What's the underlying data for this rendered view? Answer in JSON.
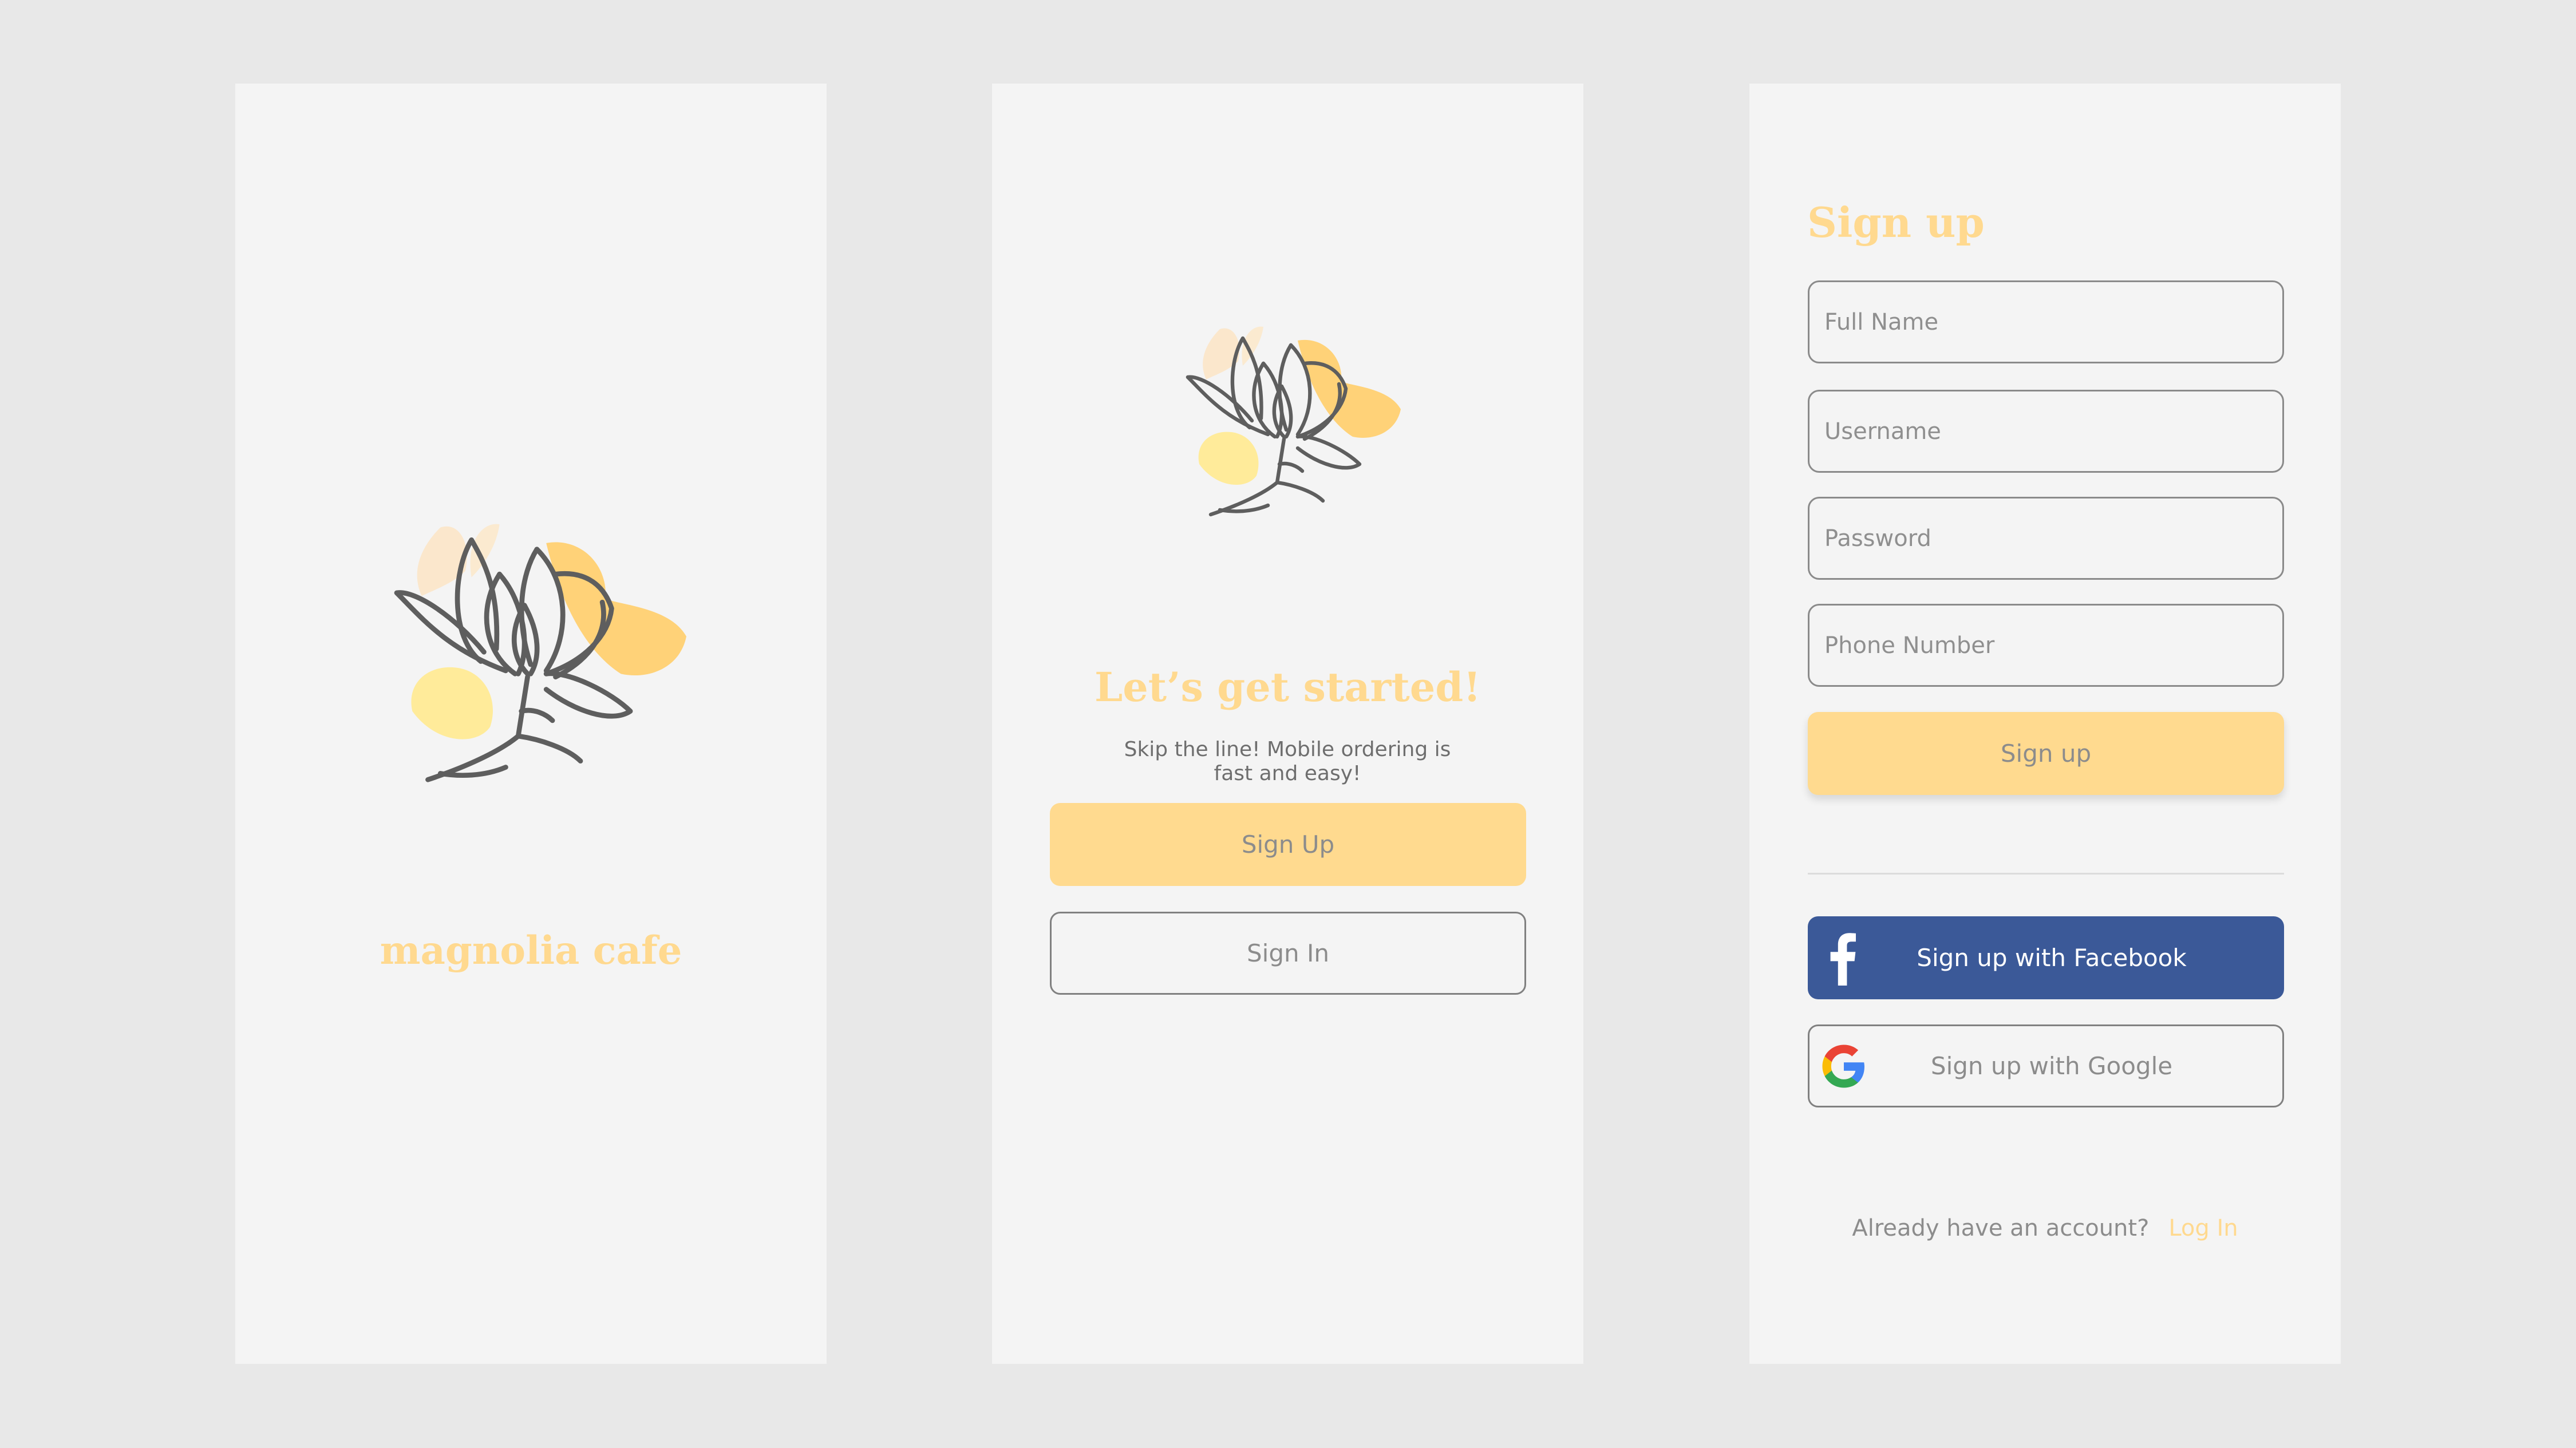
{
  "colors": {
    "page_background": "#e8e8e8",
    "screen_background": "#f4f4f4",
    "accent_yellow": "#ffda8f",
    "facebook_blue": "#3b5998",
    "text_gray": "#8c8c8c"
  },
  "splash_screen": {
    "logo_icon": "magnolia-flower-icon",
    "brand_name": "magnolia cafe"
  },
  "welcome_screen": {
    "logo_icon": "magnolia-flower-icon",
    "title": "Let’s get started!",
    "tagline": "Skip the line! Mobile ordering is fast and easy!",
    "sign_up_label": "Sign Up",
    "sign_in_label": "Sign In"
  },
  "signup_screen": {
    "title": "Sign up",
    "fields": {
      "full_name": {
        "placeholder": "Full Name",
        "value": ""
      },
      "username": {
        "placeholder": "Username",
        "value": ""
      },
      "password": {
        "placeholder": "Password",
        "value": ""
      },
      "phone_number": {
        "placeholder": "Phone Number",
        "value": ""
      }
    },
    "submit_label": "Sign up",
    "facebook": {
      "icon": "facebook-icon",
      "label": "Sign up with Facebook"
    },
    "google": {
      "icon": "google-icon",
      "label": "Sign up with Google"
    },
    "account_prompt": "Already have an account?",
    "login_link": "Log In"
  }
}
